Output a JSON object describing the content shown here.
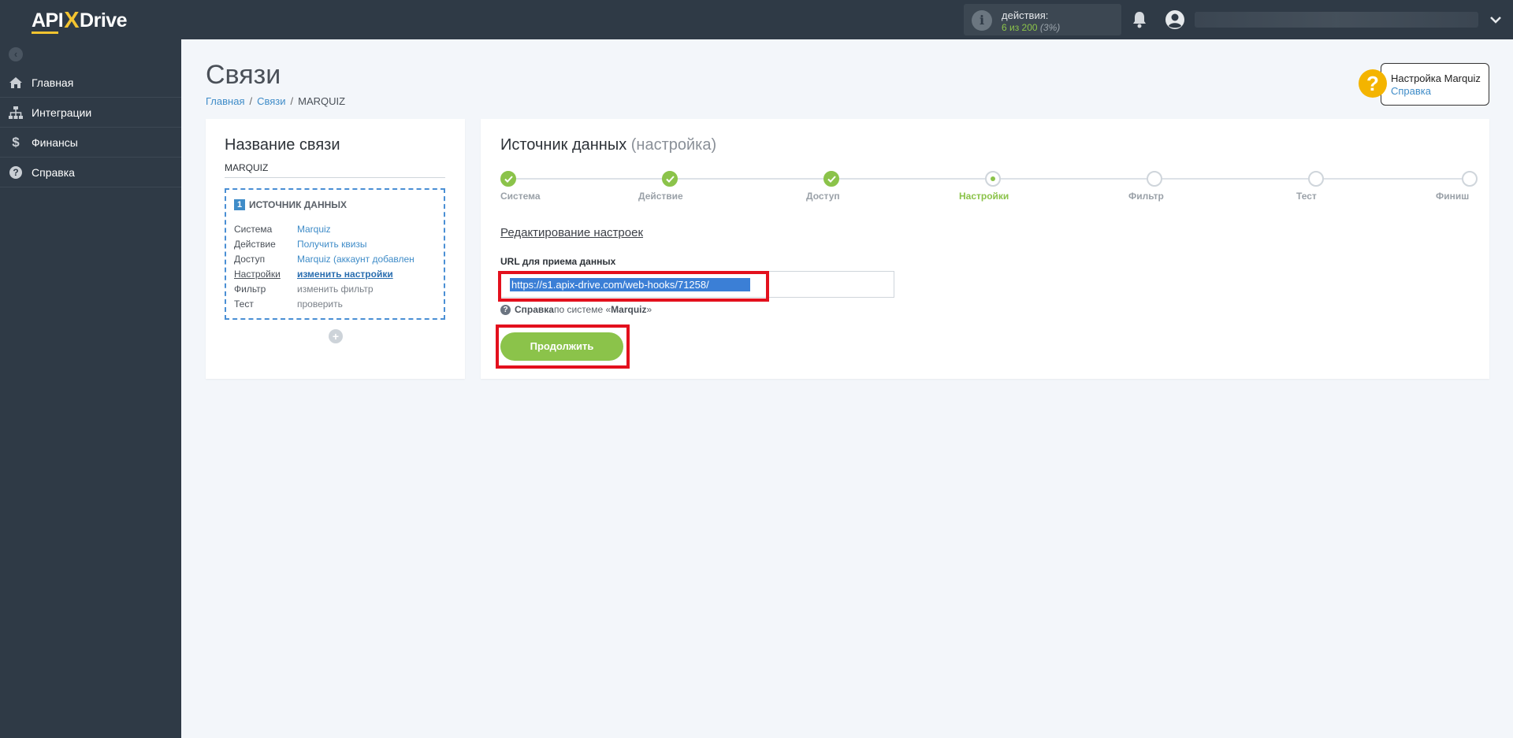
{
  "app": {
    "logo_prefix": "API",
    "logo_x": "X",
    "logo_suffix": "Drive"
  },
  "topbar": {
    "actions_label": "действия:",
    "actions_count": "6 из 200",
    "actions_percent": "(3%)"
  },
  "sidebar": {
    "items": [
      {
        "label": "Главная",
        "icon": "home-icon"
      },
      {
        "label": "Интеграции",
        "icon": "sitemap-icon"
      },
      {
        "label": "Финансы",
        "icon": "dollar-icon"
      },
      {
        "label": "Справка",
        "icon": "question-icon"
      }
    ]
  },
  "page": {
    "title": "Связи",
    "breadcrumb": [
      "Главная",
      "Связи",
      "MARQUIZ"
    ]
  },
  "help": {
    "title": "Настройка Marquiz",
    "link": "Справка"
  },
  "left_card": {
    "title": "Название связи",
    "connection_name": "MARQUIZ",
    "source_number": "1",
    "source_heading": "ИСТОЧНИК ДАННЫХ",
    "rows": [
      {
        "key": "Система",
        "value": "Marquiz"
      },
      {
        "key": "Действие",
        "value": "Получить квизы"
      },
      {
        "key": "Доступ",
        "value": "Marquiz (аккаунт добавлен"
      },
      {
        "key": "Настройки",
        "value": "изменить настройки"
      },
      {
        "key": "Фильтр",
        "value": "изменить фильтр"
      },
      {
        "key": "Тест",
        "value": "проверить"
      }
    ]
  },
  "right_card": {
    "title": "Источник данных",
    "title_sub": "(настройка)",
    "steps": [
      "Система",
      "Действие",
      "Доступ",
      "Настройки",
      "Фильтр",
      "Тест",
      "Финиш"
    ],
    "current_step": 4,
    "edit_heading": "Редактирование настроек",
    "url_label": "URL для приема данных",
    "url_value": "https://s1.apix-drive.com/web-hooks/71258/",
    "help_prefix": "Справка",
    "help_middle": " по системе «",
    "help_system": "Marquiz",
    "help_suffix": "»",
    "continue_label": "Продолжить"
  },
  "colors": {
    "sidebar_bg": "#2f3a46",
    "accent_green": "#8bc34a",
    "link_blue": "#3f8cc8",
    "highlight_red": "#e3101d",
    "help_yellow": "#f4b400"
  }
}
